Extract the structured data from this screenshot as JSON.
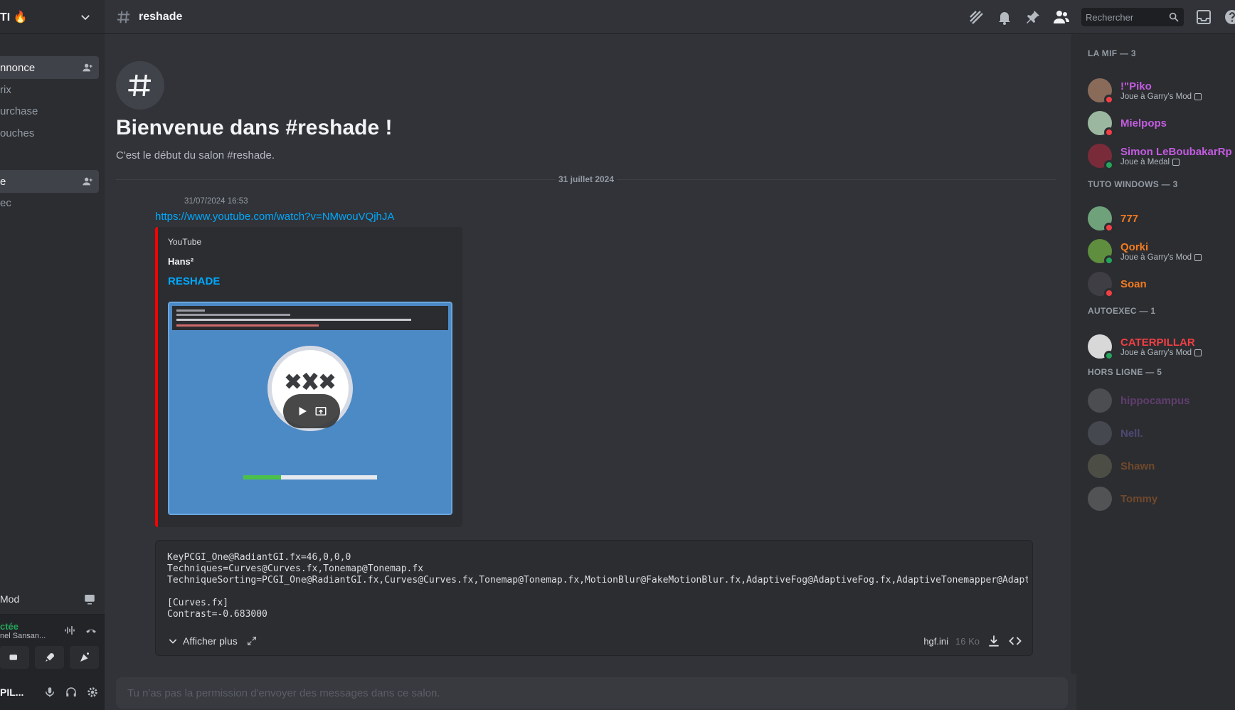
{
  "colors": {
    "accent_link": "#00a8fc",
    "online": "#23a55a",
    "dnd": "#f23f43",
    "youtube_red": "#ff0000"
  },
  "server": {
    "name": "TI 🔥"
  },
  "sidebar": {
    "channels": [
      {
        "label": "nnonce",
        "active": true
      },
      {
        "label": "rix"
      },
      {
        "label": "urchase"
      },
      {
        "label": "ouches"
      },
      {
        "label": "e",
        "active": true
      },
      {
        "label": "ec"
      }
    ],
    "voice_activity": "Mod",
    "voice_status": "ctée",
    "voice_channel": "nel Sansan...",
    "user_name": "PIL..."
  },
  "topbar": {
    "channel_name": "reshade",
    "search_placeholder": "Rechercher"
  },
  "welcome": {
    "title": "Bienvenue dans #reshade !",
    "subtitle": "C'est le début du salon #reshade."
  },
  "divider": {
    "date": "31 juillet 2024"
  },
  "message": {
    "timestamp": "31/07/2024 16:53",
    "link": "https://www.youtube.com/watch?v=NMwouVQjhJA",
    "embed": {
      "provider": "YouTube",
      "author": "Hans²",
      "title": "RESHADE",
      "thumbnail_progress": 0.28
    },
    "attachment": {
      "code": "KeyPCGI_One@RadiantGI.fx=46,0,0,0\nTechniques=Curves@Curves.fx,Tonemap@Tonemap.fx\nTechniqueSorting=PCGI_One@RadiantGI.fx,Curves@Curves.fx,Tonemap@Tonemap.fx,MotionBlur@FakeMotionBlur.fx,AdaptiveFog@AdaptiveFog.fx,AdaptiveTonemapper@AdaptiveTonemapper.fx\n\n[Curves.fx]\nContrast=-0.683000",
      "show_more": "Afficher plus",
      "file_name": "hgf.ini",
      "file_size": "16 Ko"
    }
  },
  "composer": {
    "placeholder": "Tu n'as pas la permission d'envoyer des messages dans ce salon."
  },
  "members": {
    "groups": [
      {
        "title": "LA MIF — 3"
      },
      {
        "title": "TUTO WINDOWS — 3"
      },
      {
        "title": "AUTOEXEC — 1"
      },
      {
        "title": "HORS LIGNE — 5"
      }
    ],
    "list": [
      {
        "name": "!\"Piko",
        "activity": "Joue à Garry's Mod",
        "color": "#c45ce0",
        "status": "dnd",
        "avatar": "#8a6b5a"
      },
      {
        "name": "Mielpops",
        "activity": "",
        "color": "#c45ce0",
        "status": "dnd",
        "avatar": "#9bb7a0"
      },
      {
        "name": "Simon LeBoubakarRp",
        "activity": "Joue à Medal",
        "color": "#c45ce0",
        "status": "online",
        "avatar": "#7a2b3a"
      },
      {
        "name": "777",
        "activity": "",
        "color": "#f47b20",
        "status": "dnd",
        "avatar": "#6fa27b"
      },
      {
        "name": "Qorki",
        "activity": "Joue à Garry's Mod",
        "color": "#f47b20",
        "status": "online",
        "avatar": "#5e8e3e"
      },
      {
        "name": "Soan",
        "activity": "",
        "color": "#f47b20",
        "status": "dnd",
        "avatar": "#3e3e44"
      },
      {
        "name": "CATERPILLAR",
        "activity": "Joue à Garry's Mod",
        "color": "#f23f43",
        "status": "online",
        "avatar": "#d8d8d8"
      },
      {
        "name": "hippocampus",
        "activity": "",
        "color": "#c45ce0",
        "status": "offline",
        "avatar": "#8a8a8a"
      },
      {
        "name": "Nell.",
        "activity": "",
        "color": "#8d7ee8",
        "status": "offline",
        "avatar": "#7a7a8a"
      },
      {
        "name": "Shawn",
        "activity": "",
        "color": "#f47b20",
        "status": "offline",
        "avatar": "#8a8a6a"
      },
      {
        "name": "Tommy",
        "activity": "",
        "color": "#f47b20",
        "status": "offline",
        "avatar": "#9a9a9a"
      }
    ]
  }
}
